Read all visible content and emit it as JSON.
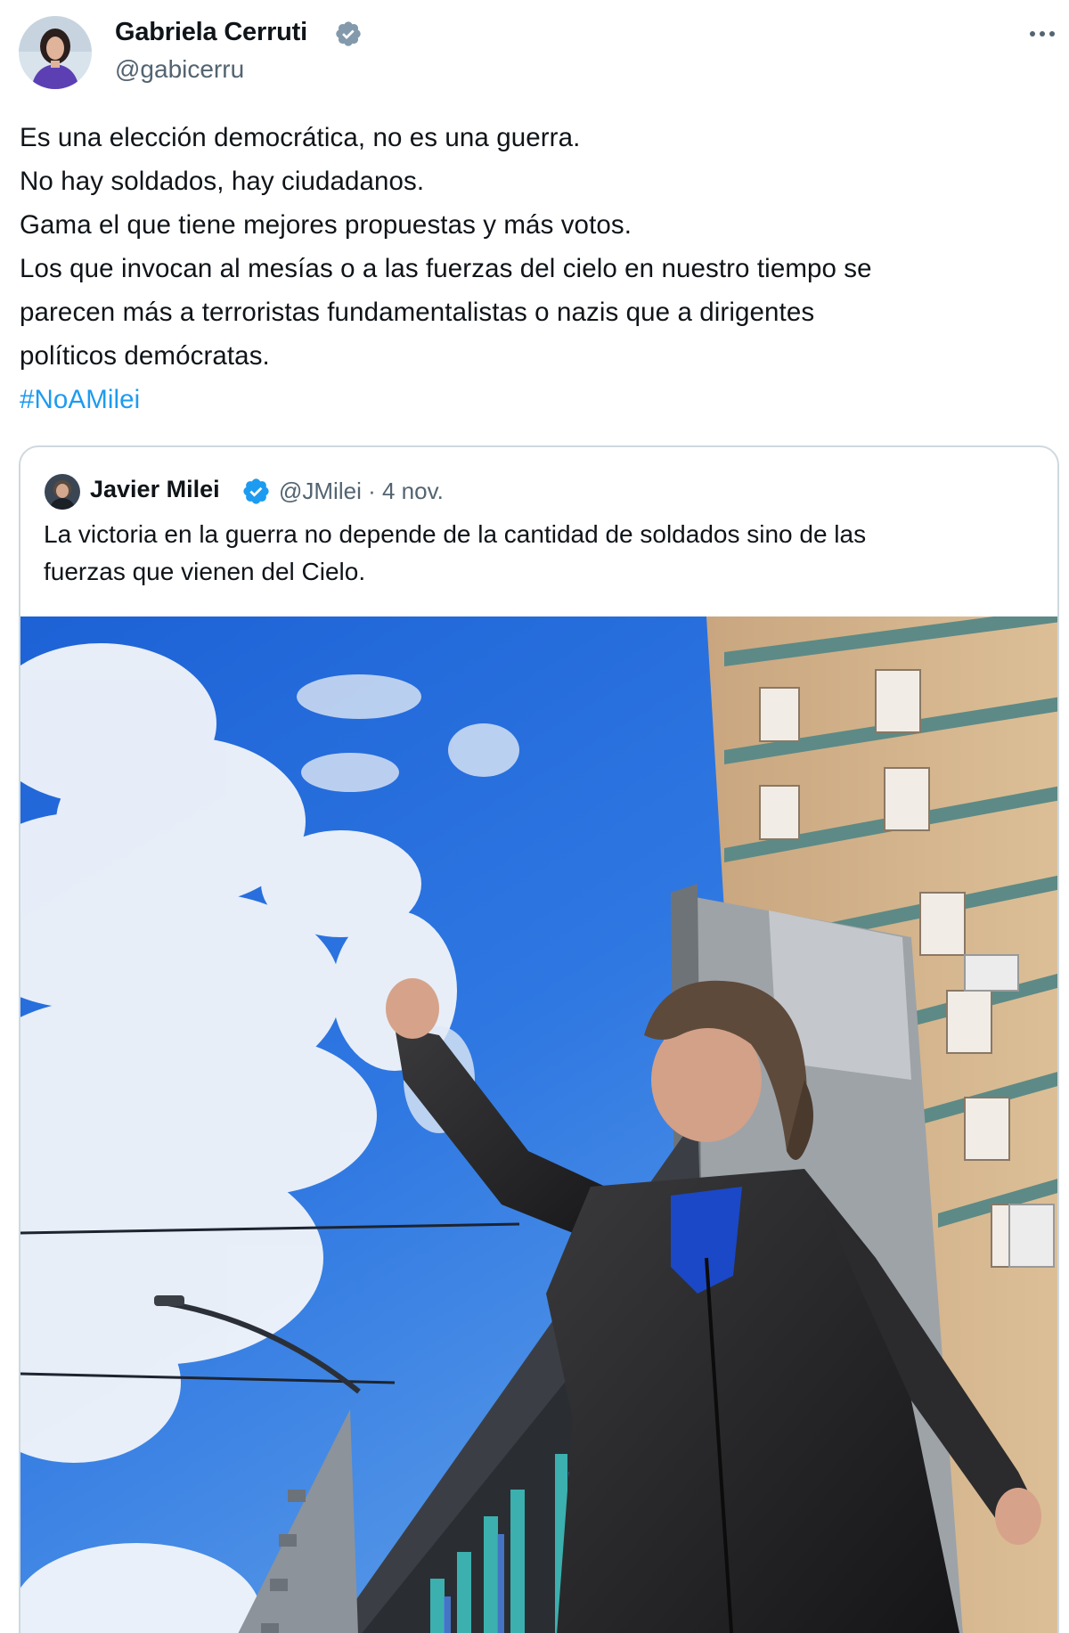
{
  "author": {
    "name": "Gabriela Cerruti",
    "handle": "@gabicerru",
    "avatar_icon": "avatar-photo",
    "verified_icon": "verified-badge-icon"
  },
  "menu": {
    "more_icon": "more-horizontal-icon"
  },
  "tweet": {
    "lines": [
      "Es una elección democrática, no es una guerra.",
      "No hay soldados, hay ciudadanos.",
      "Gama el que tiene mejores propuestas y más votos.",
      "Los que invocan al mesías o a las fuerzas del cielo en nuestro tiempo se",
      "parecen más a terroristas fundamentalistas o nazis que a dirigentes",
      "políticos demócratas."
    ],
    "hashtag": "#NoAMilei"
  },
  "quote": {
    "name": "Javier Milei",
    "handle": "@JMilei",
    "separator": "·",
    "date": "4 nov.",
    "lines": [
      "La victoria en la guerra no depende de la cantidad de soldados sino de las",
      "fuerzas que vienen del Cielo."
    ]
  },
  "colors": {
    "text": "#0f1419",
    "secondary": "#536471",
    "accent": "#1d9bf0",
    "border": "#cfd9de"
  }
}
